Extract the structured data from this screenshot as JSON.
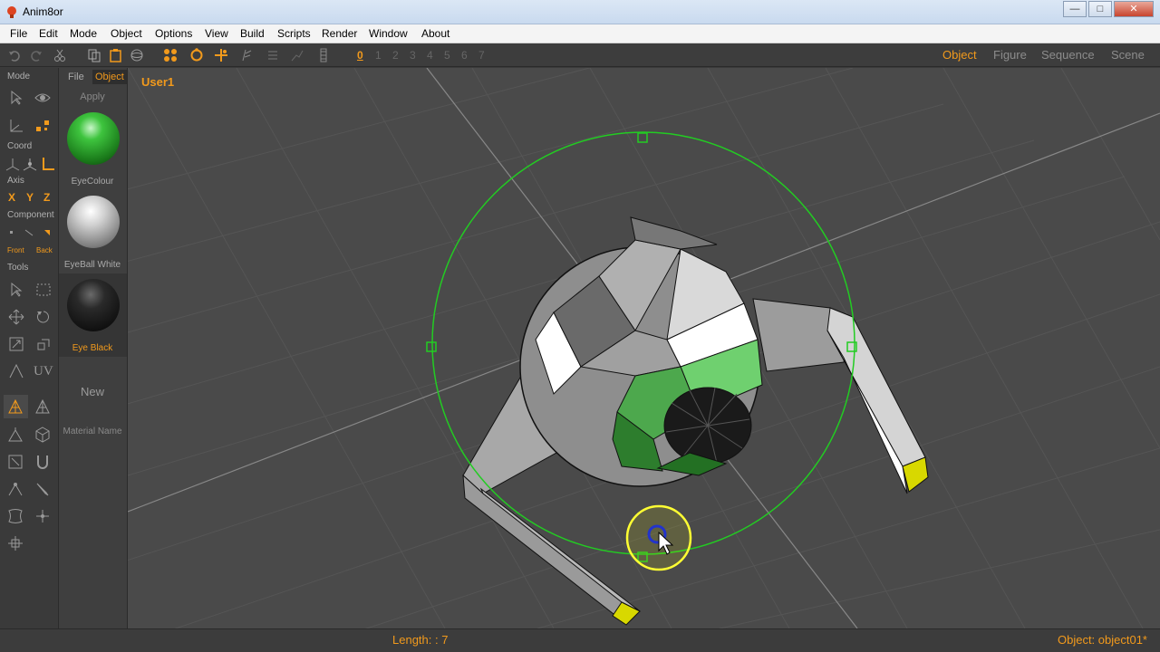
{
  "window": {
    "title": "Anim8or",
    "min": "—",
    "max": "□",
    "close": "✕"
  },
  "menu": [
    "File",
    "Edit",
    "Mode",
    "Object",
    "Options",
    "View",
    "Build",
    "Scripts",
    "Render",
    "Window",
    "About"
  ],
  "toolbar": {
    "layers": [
      "0",
      "1",
      "2",
      "3",
      "4",
      "5",
      "6",
      "7"
    ],
    "modes": [
      "Object",
      "Figure",
      "Sequence",
      "Scene"
    ],
    "active_mode": "Object"
  },
  "left_panel": {
    "mode_label": "Mode",
    "coord_label": "Coord",
    "axis_label": "Axis",
    "axis": [
      "X",
      "Y",
      "Z"
    ],
    "component_label": "Component",
    "front": "Front",
    "back": "Back",
    "tools_label": "Tools",
    "uv": "UV"
  },
  "materials": {
    "tabs": [
      "File",
      "Object"
    ],
    "apply": "Apply",
    "items": [
      {
        "name": "EyeColour",
        "color": "#2fae2f"
      },
      {
        "name": "EyeBall White",
        "color": "#d8d8d8"
      },
      {
        "name": "Eye Black",
        "color": "#1a1a1a"
      }
    ],
    "new": "New",
    "material_name": "Material Name"
  },
  "viewport": {
    "label": "User1"
  },
  "status": {
    "length": "Length: : 7",
    "object": "Object: object01*"
  },
  "colors": {
    "accent": "#f29a1c",
    "selection": "#22cc22"
  }
}
